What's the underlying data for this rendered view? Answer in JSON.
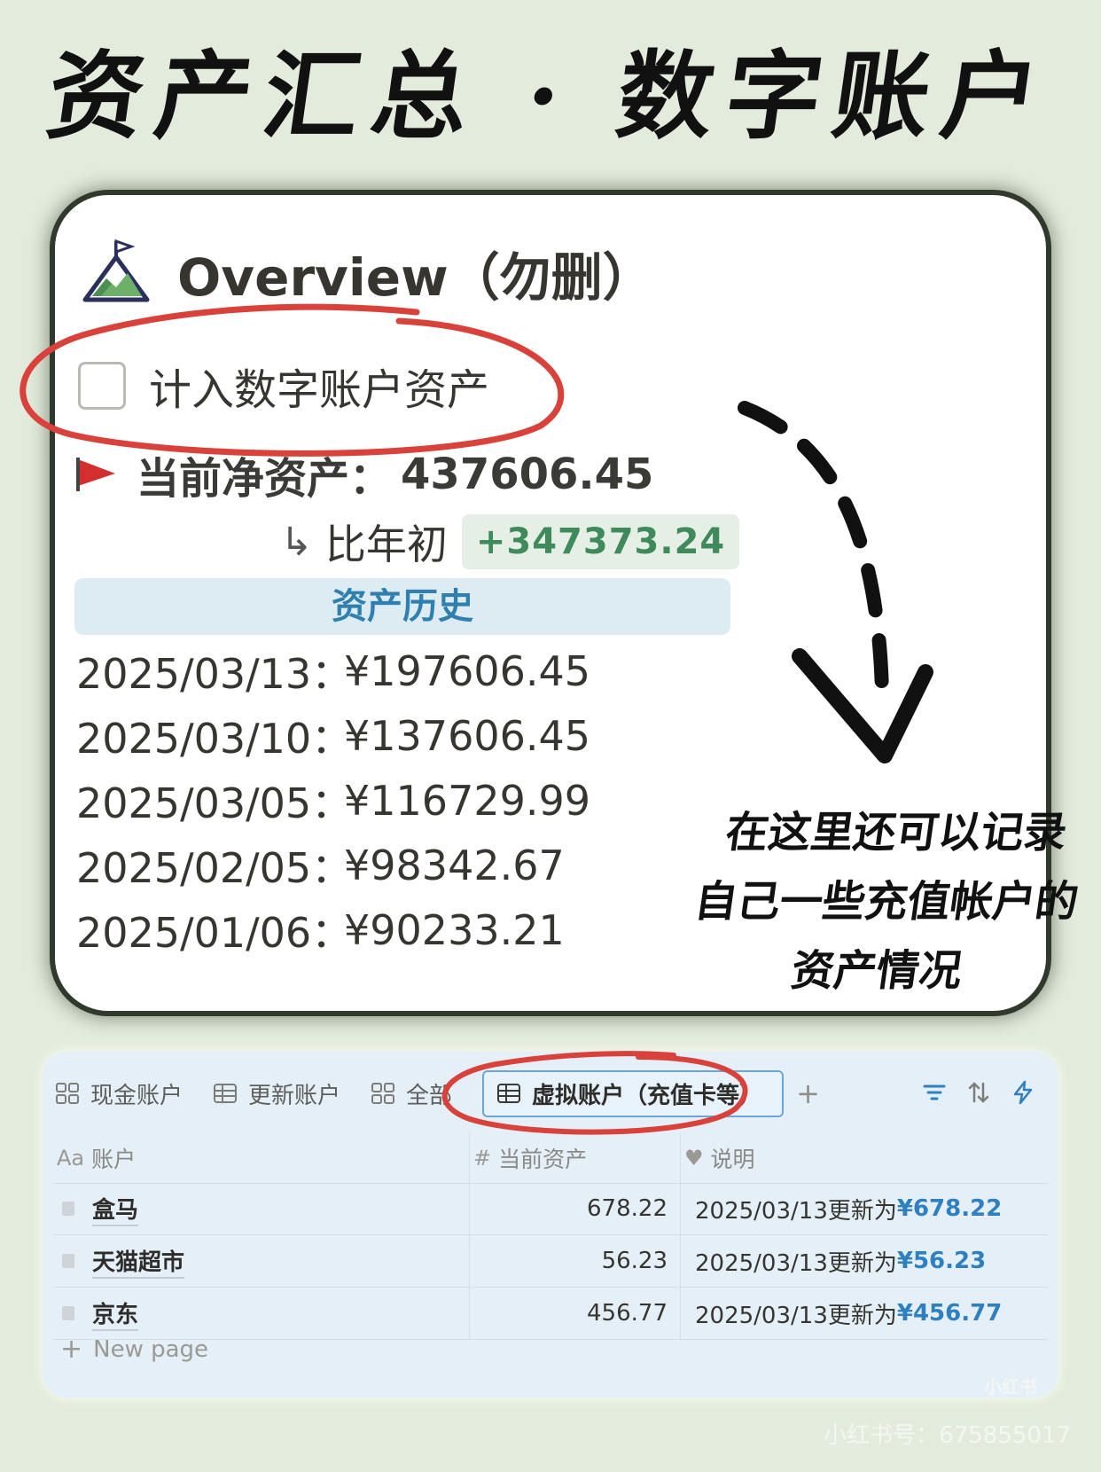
{
  "banner_title": "资产汇总 · 数字账户",
  "overview": {
    "title": "Overview（勿删）",
    "checkbox_label": "计入数字账户资产",
    "net_asset_label": "当前净资产：",
    "net_asset_value": "437606.45",
    "compare_arrow": "↳",
    "compare_label": "比年初",
    "compare_value": "+347373.24",
    "history_header": "资产历史",
    "history": [
      {
        "date": "2025/03/13：",
        "amount": "¥197606.45"
      },
      {
        "date": "2025/03/10：",
        "amount": "¥137606.45"
      },
      {
        "date": "2025/03/05：",
        "amount": " ¥116729.99"
      },
      {
        "date": "2025/02/05：",
        "amount": " ¥98342.67"
      },
      {
        "date": "2025/01/06：",
        "amount": "¥90233.21"
      }
    ]
  },
  "annotation": {
    "lines": [
      "在这里还可以记录",
      "自己一些充值帐户的",
      "资产情况"
    ]
  },
  "table": {
    "tabs": [
      {
        "label": "现金账户",
        "icon": "gallery-icon"
      },
      {
        "label": "更新账户",
        "icon": "table-icon"
      },
      {
        "label": "全部",
        "icon": "gallery-icon"
      },
      {
        "label": "虚拟账户（充值卡等）",
        "icon": "table-icon",
        "active": true
      }
    ],
    "add_tab": "+",
    "columns": [
      {
        "icon": "Aa",
        "label": "账户"
      },
      {
        "icon": "#",
        "label": "当前资产"
      },
      {
        "icon": "♥",
        "label": "说明"
      }
    ],
    "rows": [
      {
        "name": "盒马",
        "value": "678.22",
        "note_prefix": "2025/03/13更新为 ",
        "note_amount": "¥678.22"
      },
      {
        "name": "天猫超市",
        "value": "56.23",
        "note_prefix": "2025/03/13更新为 ",
        "note_amount": "¥56.23"
      },
      {
        "name": "京东",
        "value": "456.77",
        "note_prefix": "2025/03/13更新为 ",
        "note_amount": "¥456.77"
      }
    ],
    "new_page": "New page"
  },
  "watermark": {
    "logo": "小红书",
    "id_text": "小红书号：675855017"
  },
  "colors": {
    "background": "#e3ecdc",
    "positive_green": "#3f8a5a",
    "link_blue": "#2f80c0",
    "annotation_red": "#d9413b"
  }
}
